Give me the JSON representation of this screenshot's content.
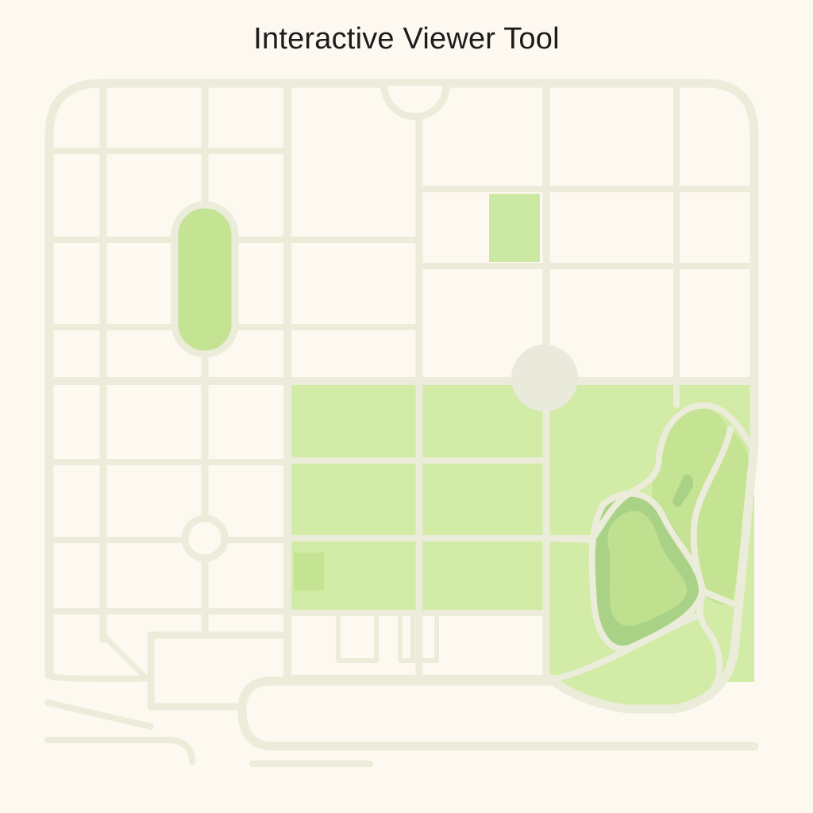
{
  "header": {
    "title": "Interactive Viewer Tool"
  },
  "map": {
    "colors": {
      "background": "#fdf9f1",
      "road": "#ebecd9",
      "park_light": "#d2eba6",
      "park_mid": "#c4e393",
      "park_dark": "#a9d286",
      "plaza": "#e9eadb"
    },
    "features": [
      "road-grid",
      "west-oval-park",
      "north-small-park",
      "central-park-blocks",
      "east-hill-park",
      "central-roundabout",
      "west-roundabout",
      "north-semicircle-plaza"
    ]
  }
}
